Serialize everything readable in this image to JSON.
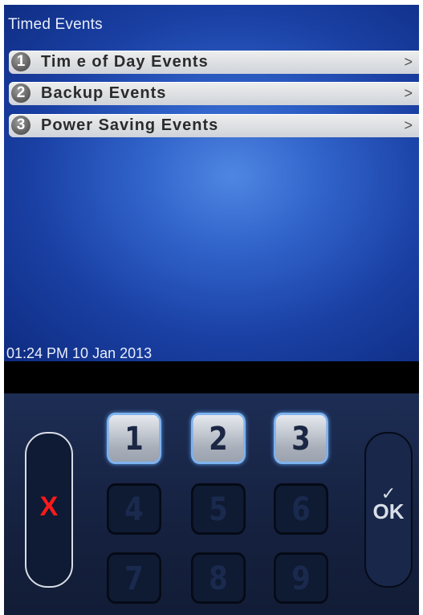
{
  "screen": {
    "title": "Timed Events",
    "menu": [
      {
        "number": "1",
        "label": "Tim e of Day Events",
        "chevron": ">"
      },
      {
        "number": "2",
        "label": "Backup Events",
        "chevron": ">"
      },
      {
        "number": "3",
        "label": "Power Saving Events",
        "chevron": ">"
      }
    ],
    "timestamp": "01:24 PM 10 Jan 2013"
  },
  "keypad": {
    "cancel_symbol": "X",
    "ok_check": "✓",
    "ok_label": "OK",
    "keys": [
      "1",
      "2",
      "3",
      "4",
      "5",
      "6",
      "7",
      "8",
      "9"
    ],
    "active_keys": [
      "1",
      "2",
      "3"
    ]
  },
  "colors": {
    "screen_blue": "#2f61c8",
    "menu_bar": "#dcdfe4",
    "cancel_red": "#ff1a1a",
    "key_highlight": "#7fb3f0"
  }
}
